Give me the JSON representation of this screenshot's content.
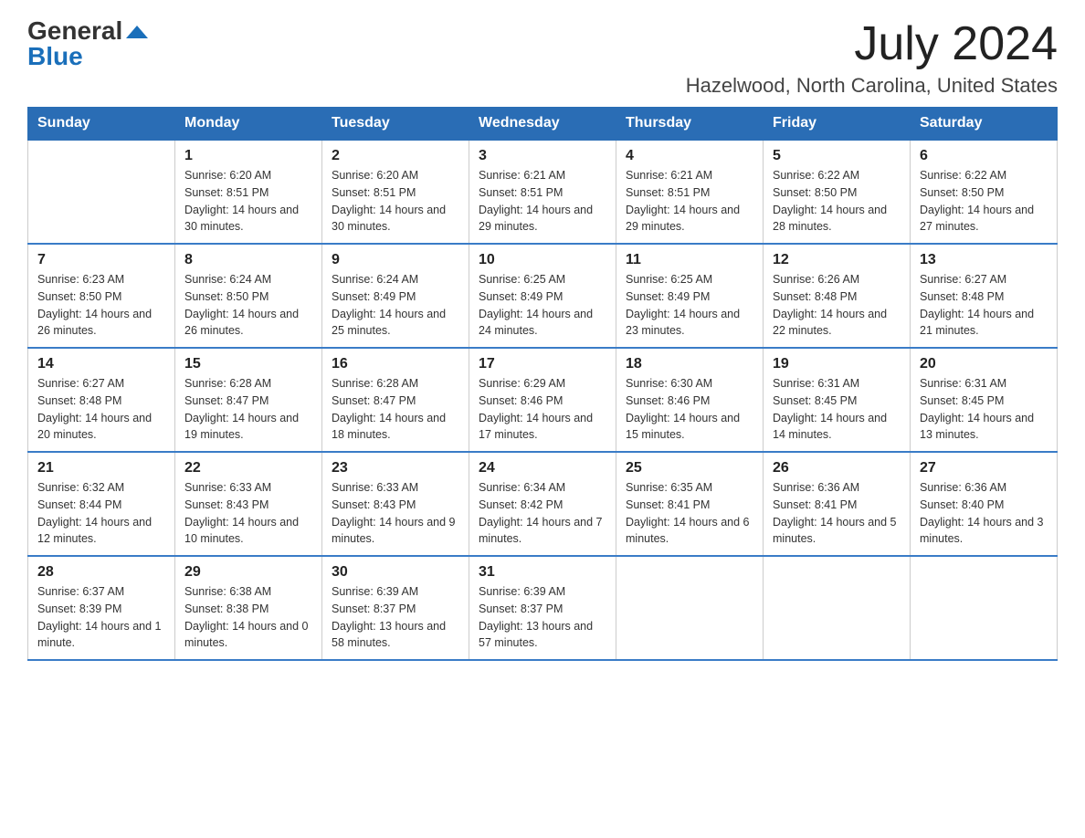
{
  "logo": {
    "text_general": "General",
    "text_blue": "Blue",
    "aria": "GeneralBlue logo"
  },
  "title": {
    "month": "July 2024",
    "location": "Hazelwood, North Carolina, United States"
  },
  "days_of_week": [
    "Sunday",
    "Monday",
    "Tuesday",
    "Wednesday",
    "Thursday",
    "Friday",
    "Saturday"
  ],
  "weeks": [
    [
      {
        "day": "",
        "sunrise": "",
        "sunset": "",
        "daylight": ""
      },
      {
        "day": "1",
        "sunrise": "Sunrise: 6:20 AM",
        "sunset": "Sunset: 8:51 PM",
        "daylight": "Daylight: 14 hours and 30 minutes."
      },
      {
        "day": "2",
        "sunrise": "Sunrise: 6:20 AM",
        "sunset": "Sunset: 8:51 PM",
        "daylight": "Daylight: 14 hours and 30 minutes."
      },
      {
        "day": "3",
        "sunrise": "Sunrise: 6:21 AM",
        "sunset": "Sunset: 8:51 PM",
        "daylight": "Daylight: 14 hours and 29 minutes."
      },
      {
        "day": "4",
        "sunrise": "Sunrise: 6:21 AM",
        "sunset": "Sunset: 8:51 PM",
        "daylight": "Daylight: 14 hours and 29 minutes."
      },
      {
        "day": "5",
        "sunrise": "Sunrise: 6:22 AM",
        "sunset": "Sunset: 8:50 PM",
        "daylight": "Daylight: 14 hours and 28 minutes."
      },
      {
        "day": "6",
        "sunrise": "Sunrise: 6:22 AM",
        "sunset": "Sunset: 8:50 PM",
        "daylight": "Daylight: 14 hours and 27 minutes."
      }
    ],
    [
      {
        "day": "7",
        "sunrise": "Sunrise: 6:23 AM",
        "sunset": "Sunset: 8:50 PM",
        "daylight": "Daylight: 14 hours and 26 minutes."
      },
      {
        "day": "8",
        "sunrise": "Sunrise: 6:24 AM",
        "sunset": "Sunset: 8:50 PM",
        "daylight": "Daylight: 14 hours and 26 minutes."
      },
      {
        "day": "9",
        "sunrise": "Sunrise: 6:24 AM",
        "sunset": "Sunset: 8:49 PM",
        "daylight": "Daylight: 14 hours and 25 minutes."
      },
      {
        "day": "10",
        "sunrise": "Sunrise: 6:25 AM",
        "sunset": "Sunset: 8:49 PM",
        "daylight": "Daylight: 14 hours and 24 minutes."
      },
      {
        "day": "11",
        "sunrise": "Sunrise: 6:25 AM",
        "sunset": "Sunset: 8:49 PM",
        "daylight": "Daylight: 14 hours and 23 minutes."
      },
      {
        "day": "12",
        "sunrise": "Sunrise: 6:26 AM",
        "sunset": "Sunset: 8:48 PM",
        "daylight": "Daylight: 14 hours and 22 minutes."
      },
      {
        "day": "13",
        "sunrise": "Sunrise: 6:27 AM",
        "sunset": "Sunset: 8:48 PM",
        "daylight": "Daylight: 14 hours and 21 minutes."
      }
    ],
    [
      {
        "day": "14",
        "sunrise": "Sunrise: 6:27 AM",
        "sunset": "Sunset: 8:48 PM",
        "daylight": "Daylight: 14 hours and 20 minutes."
      },
      {
        "day": "15",
        "sunrise": "Sunrise: 6:28 AM",
        "sunset": "Sunset: 8:47 PM",
        "daylight": "Daylight: 14 hours and 19 minutes."
      },
      {
        "day": "16",
        "sunrise": "Sunrise: 6:28 AM",
        "sunset": "Sunset: 8:47 PM",
        "daylight": "Daylight: 14 hours and 18 minutes."
      },
      {
        "day": "17",
        "sunrise": "Sunrise: 6:29 AM",
        "sunset": "Sunset: 8:46 PM",
        "daylight": "Daylight: 14 hours and 17 minutes."
      },
      {
        "day": "18",
        "sunrise": "Sunrise: 6:30 AM",
        "sunset": "Sunset: 8:46 PM",
        "daylight": "Daylight: 14 hours and 15 minutes."
      },
      {
        "day": "19",
        "sunrise": "Sunrise: 6:31 AM",
        "sunset": "Sunset: 8:45 PM",
        "daylight": "Daylight: 14 hours and 14 minutes."
      },
      {
        "day": "20",
        "sunrise": "Sunrise: 6:31 AM",
        "sunset": "Sunset: 8:45 PM",
        "daylight": "Daylight: 14 hours and 13 minutes."
      }
    ],
    [
      {
        "day": "21",
        "sunrise": "Sunrise: 6:32 AM",
        "sunset": "Sunset: 8:44 PM",
        "daylight": "Daylight: 14 hours and 12 minutes."
      },
      {
        "day": "22",
        "sunrise": "Sunrise: 6:33 AM",
        "sunset": "Sunset: 8:43 PM",
        "daylight": "Daylight: 14 hours and 10 minutes."
      },
      {
        "day": "23",
        "sunrise": "Sunrise: 6:33 AM",
        "sunset": "Sunset: 8:43 PM",
        "daylight": "Daylight: 14 hours and 9 minutes."
      },
      {
        "day": "24",
        "sunrise": "Sunrise: 6:34 AM",
        "sunset": "Sunset: 8:42 PM",
        "daylight": "Daylight: 14 hours and 7 minutes."
      },
      {
        "day": "25",
        "sunrise": "Sunrise: 6:35 AM",
        "sunset": "Sunset: 8:41 PM",
        "daylight": "Daylight: 14 hours and 6 minutes."
      },
      {
        "day": "26",
        "sunrise": "Sunrise: 6:36 AM",
        "sunset": "Sunset: 8:41 PM",
        "daylight": "Daylight: 14 hours and 5 minutes."
      },
      {
        "day": "27",
        "sunrise": "Sunrise: 6:36 AM",
        "sunset": "Sunset: 8:40 PM",
        "daylight": "Daylight: 14 hours and 3 minutes."
      }
    ],
    [
      {
        "day": "28",
        "sunrise": "Sunrise: 6:37 AM",
        "sunset": "Sunset: 8:39 PM",
        "daylight": "Daylight: 14 hours and 1 minute."
      },
      {
        "day": "29",
        "sunrise": "Sunrise: 6:38 AM",
        "sunset": "Sunset: 8:38 PM",
        "daylight": "Daylight: 14 hours and 0 minutes."
      },
      {
        "day": "30",
        "sunrise": "Sunrise: 6:39 AM",
        "sunset": "Sunset: 8:37 PM",
        "daylight": "Daylight: 13 hours and 58 minutes."
      },
      {
        "day": "31",
        "sunrise": "Sunrise: 6:39 AM",
        "sunset": "Sunset: 8:37 PM",
        "daylight": "Daylight: 13 hours and 57 minutes."
      },
      {
        "day": "",
        "sunrise": "",
        "sunset": "",
        "daylight": ""
      },
      {
        "day": "",
        "sunrise": "",
        "sunset": "",
        "daylight": ""
      },
      {
        "day": "",
        "sunrise": "",
        "sunset": "",
        "daylight": ""
      }
    ]
  ]
}
